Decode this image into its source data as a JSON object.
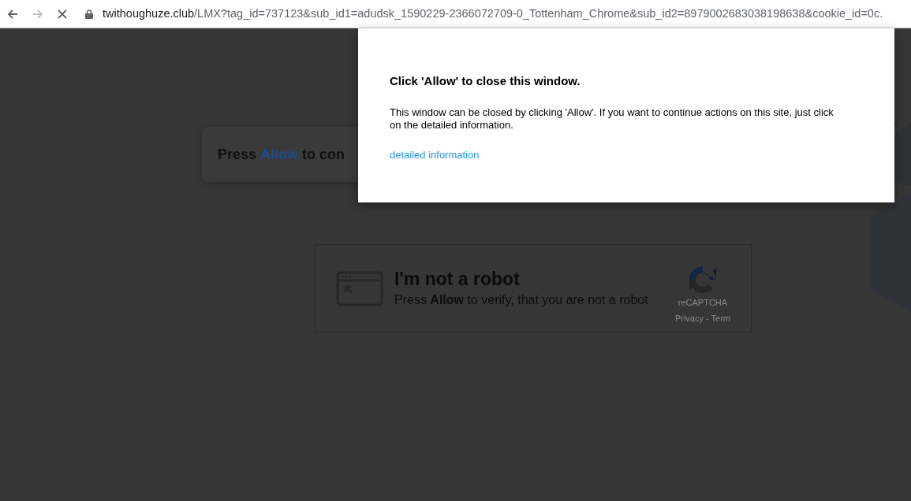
{
  "browser": {
    "url_domain": "twithoughuze.club",
    "url_path": "/LMX?tag_id=737123&sub_id1=adudsk_1590229-2366072709-0_Tottenham_Chrome&sub_id2=8979002683038198638&cookie_id=0c."
  },
  "page_card": {
    "text": "Press **Allow** to con"
  },
  "captcha": {
    "title": "I'm not a robot",
    "subtitle": "Press **Allow** to verify, that you are not a robot",
    "brand": "reCAPTCHA",
    "links": "Privacy - Term"
  },
  "dialog": {
    "title": "Click 'Allow' to close this window.",
    "body": "This window can be closed by clicking 'Allow'. If you want to continue actions on this site, just click on the detailed information.",
    "link": "detailed information"
  }
}
